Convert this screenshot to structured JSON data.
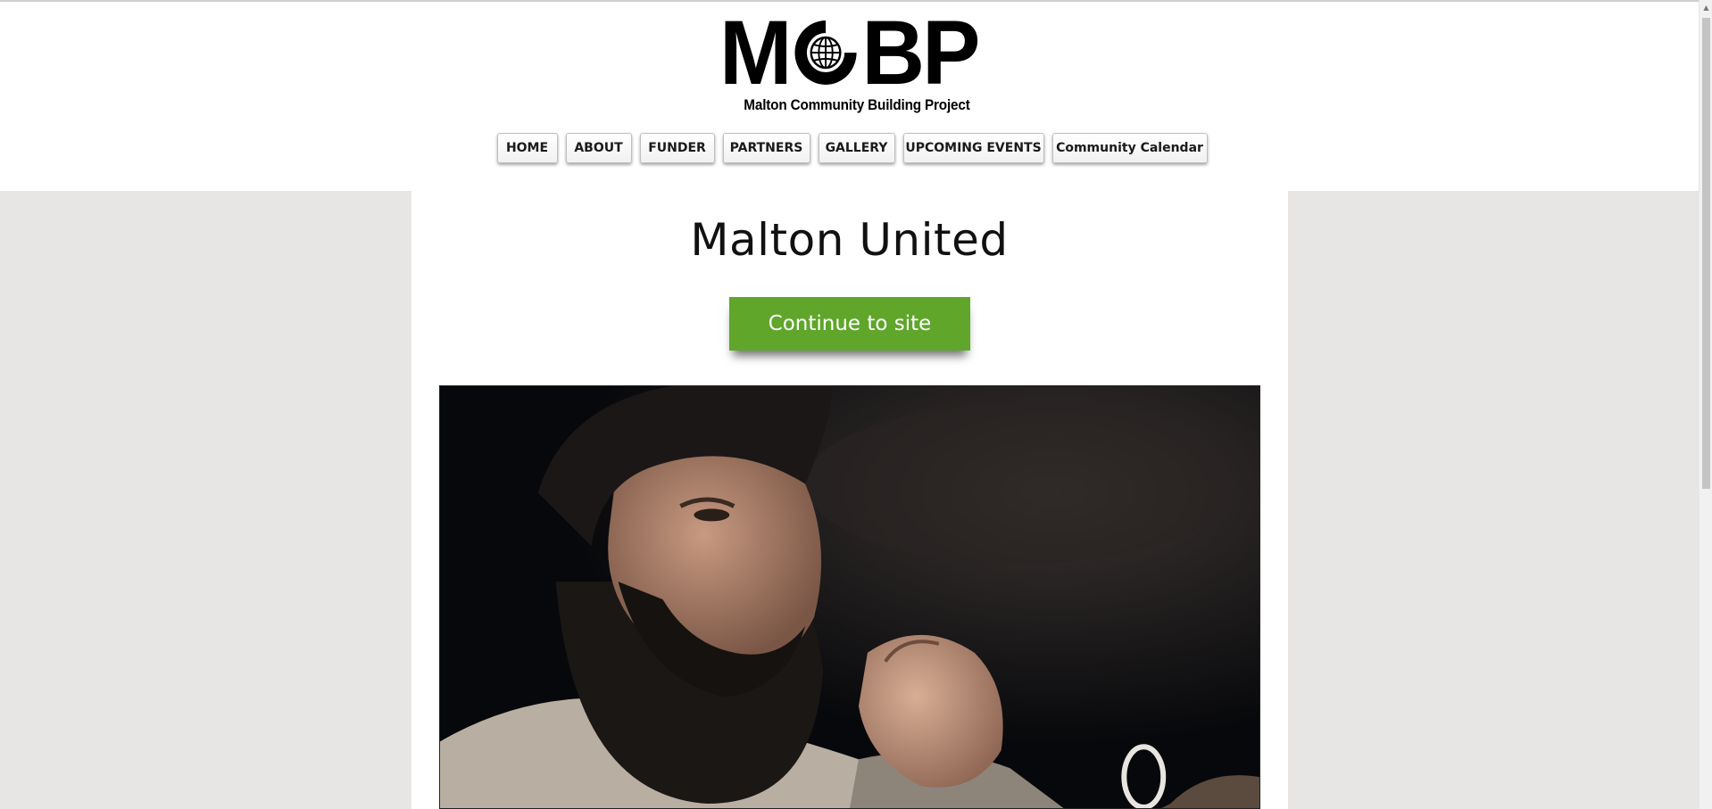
{
  "logo": {
    "letters_left": "M",
    "letters_right": "BP",
    "tagline": "Malton Community Building Project"
  },
  "nav": {
    "items": [
      {
        "label": "HOME"
      },
      {
        "label": "ABOUT"
      },
      {
        "label": "FUNDER"
      },
      {
        "label": "PARTNERS"
      },
      {
        "label": "GALLERY"
      },
      {
        "label": "UPCOMING EVENTS"
      },
      {
        "label": "Community Calendar"
      }
    ]
  },
  "main": {
    "title": "Malton United",
    "cta_label": "Continue to site"
  },
  "colors": {
    "cta_green": "#5fa62a",
    "side_gray": "#e8e5e5"
  },
  "icons": {
    "logo_globe": "globe-icon"
  }
}
